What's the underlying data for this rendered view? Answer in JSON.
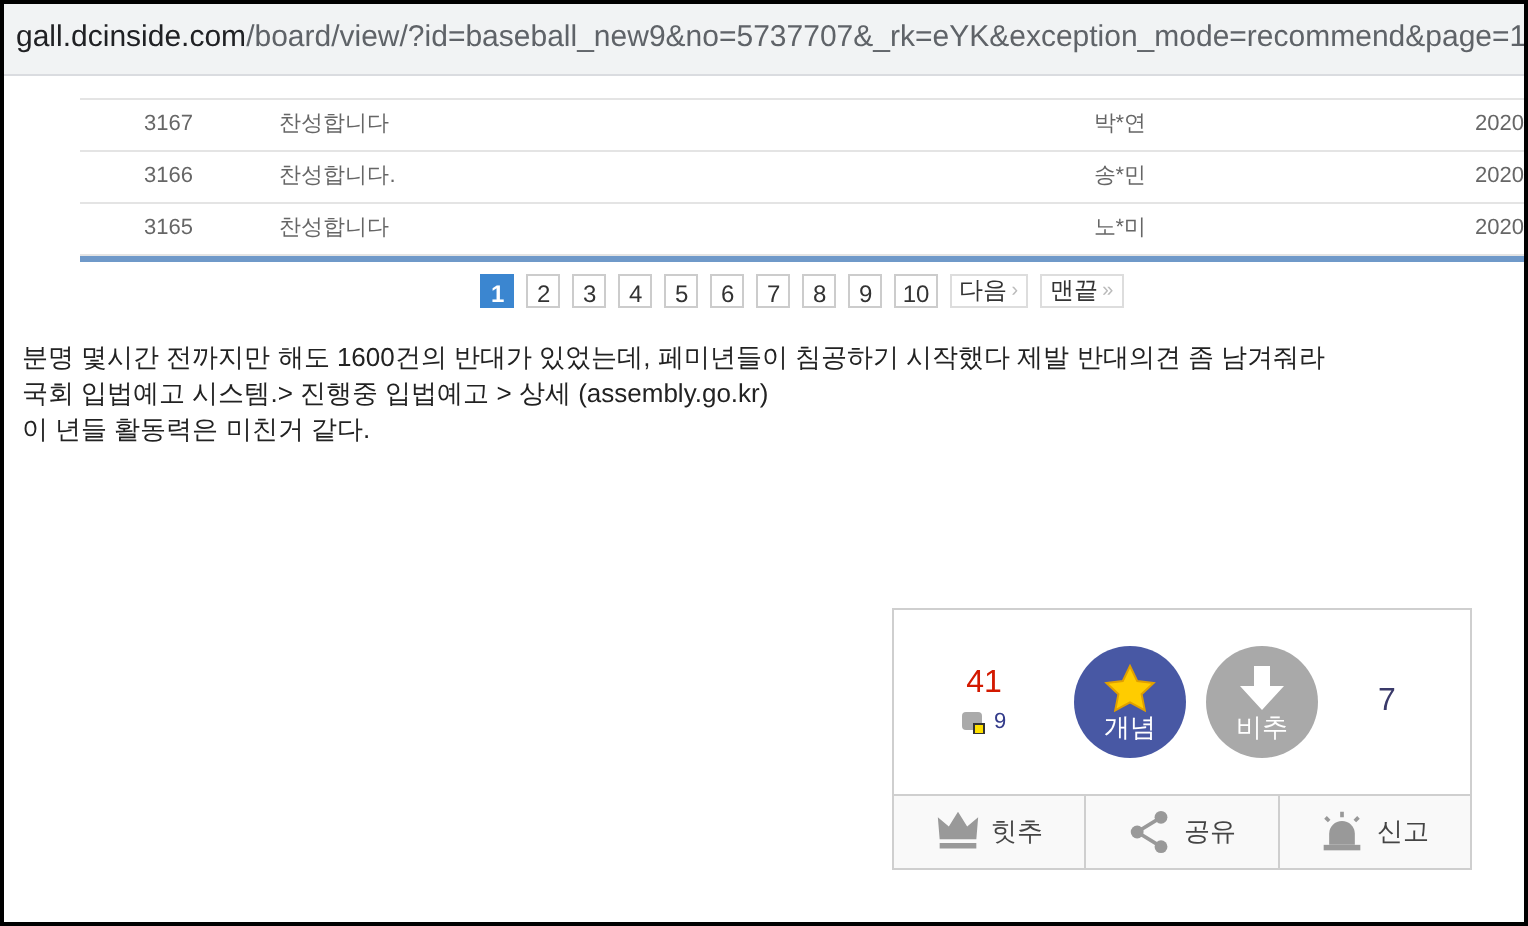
{
  "address_bar": {
    "domain": "gall.dcinside.com",
    "path": "/board/view/?id=baseball_new9&no=5737707&_rk=eYK&exception_mode=recommend&page=1"
  },
  "table": {
    "rows": [
      {
        "number": "3167",
        "opinion": "찬성합니다",
        "author": "박*연",
        "date": "2020"
      },
      {
        "number": "3166",
        "opinion": "찬성합니다.",
        "author": "송*민",
        "date": "2020"
      },
      {
        "number": "3165",
        "opinion": "찬성합니다",
        "author": "노*미",
        "date": "2020"
      }
    ]
  },
  "pagination": {
    "pages": [
      {
        "label": "1",
        "selected": true
      },
      {
        "label": "2",
        "selected": false
      },
      {
        "label": "3",
        "selected": false
      },
      {
        "label": "4",
        "selected": false
      },
      {
        "label": "5",
        "selected": false
      },
      {
        "label": "6",
        "selected": false
      },
      {
        "label": "7",
        "selected": false
      },
      {
        "label": "8",
        "selected": false
      },
      {
        "label": "9",
        "selected": false
      },
      {
        "label": "10",
        "selected": false
      }
    ],
    "next": "다음",
    "next_arrow": "›",
    "last": "맨끝",
    "last_arrow": "»"
  },
  "post_body": [
    "분명 몇시간 전까지만 해도 1600건의 반대가 있었는데, 페미년들이 침공하기 시작했다 제발 반대의견 좀 남겨줘라",
    "국회 입법예고 시스템.> 진행중 입법예고 > 상세 (assembly.go.kr)",
    "이 년들 활동력은 미친거 같다."
  ],
  "votes": {
    "up_count": "41",
    "fixed_count": "9",
    "up_label": "개념",
    "down_label": "비추",
    "down_count": "7"
  },
  "actions": [
    "힛추",
    "공유",
    "신고"
  ]
}
